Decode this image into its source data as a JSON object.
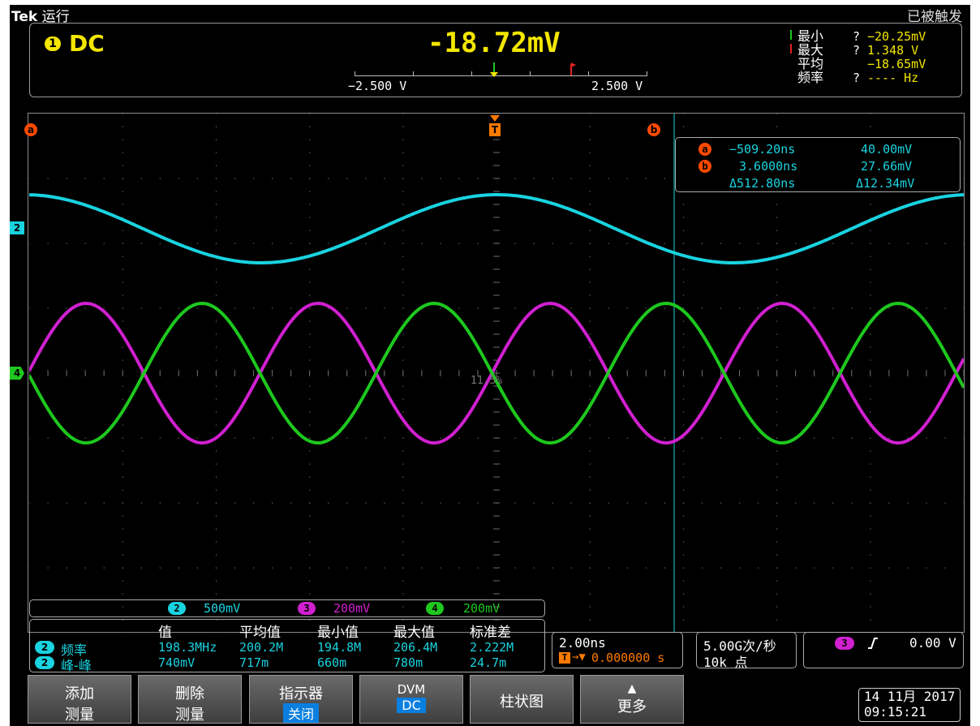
{
  "header": {
    "brand": "Tek",
    "run_state": "运行",
    "trigger_status": "已被触发"
  },
  "dvm": {
    "channel": "1",
    "mode": "DC",
    "value": "-18.72mV",
    "scale_min": "−2.500 V",
    "scale_max": "2.500 V",
    "stats": [
      {
        "label": "最小",
        "q": "?",
        "value": "−20.25mV"
      },
      {
        "label": "最大",
        "q": "?",
        "value": "1.348 V"
      },
      {
        "label": "平均",
        "q": "",
        "value": "−18.65mV"
      },
      {
        "label": "频率",
        "q": "?",
        "value": "---- Hz"
      }
    ]
  },
  "screen": {
    "cursor_a_label": "a",
    "cursor_b_label": "b",
    "trigger_label": "T",
    "center_text": "11.5%",
    "left_markers": [
      "2",
      "4"
    ]
  },
  "cursor_readout": {
    "a_time": "−509.20ns",
    "a_volt": "40.00mV",
    "b_time": "3.6000ns",
    "b_volt": "27.66mV",
    "delta_time": "Δ512.80ns",
    "delta_volt": "Δ12.34mV"
  },
  "channels": [
    {
      "num": "2",
      "scale": "500mV",
      "color": "#19d3e0"
    },
    {
      "num": "3",
      "scale": "200mV",
      "color": "#d020d0"
    },
    {
      "num": "4",
      "scale": "200mV",
      "color": "#1ec81e"
    }
  ],
  "measurements": {
    "headers": [
      "值",
      "平均值",
      "最小值",
      "最大值",
      "标准差"
    ],
    "rows": [
      {
        "ch": "2",
        "name": "频率",
        "values": [
          "198.3MHz",
          "200.2M",
          "194.8M",
          "206.4M",
          "2.222M"
        ]
      },
      {
        "ch": "2",
        "name": "峰-峰",
        "values": [
          "740mV",
          "717m",
          "660m",
          "780m",
          "24.7m"
        ]
      }
    ]
  },
  "timebase": {
    "scale": "2.00ns",
    "position": "0.000000 s"
  },
  "sampling": {
    "rate": "5.00G次/秒",
    "points": "10k 点"
  },
  "trigger": {
    "channel": "3",
    "slope": "╱",
    "level": "0.00 V"
  },
  "softkeys": [
    {
      "line1": "添加",
      "line2": "测量"
    },
    {
      "line1": "删除",
      "line2": "测量"
    },
    {
      "line1": "指示器",
      "line2": "关闭"
    },
    {
      "line1": "DVM",
      "line2": "DC"
    },
    {
      "line1": "柱状图",
      "line2": ""
    },
    {
      "line1": "▲",
      "line2": "更多"
    }
  ],
  "datetime": {
    "date": "14 11月 2017",
    "time": "09:15:21"
  },
  "colors": {
    "cyan": "#19d3e0",
    "magenta": "#d020d0",
    "green": "#1ec81e",
    "yellow": "#f3e600",
    "orange": "#ff7a00"
  }
}
